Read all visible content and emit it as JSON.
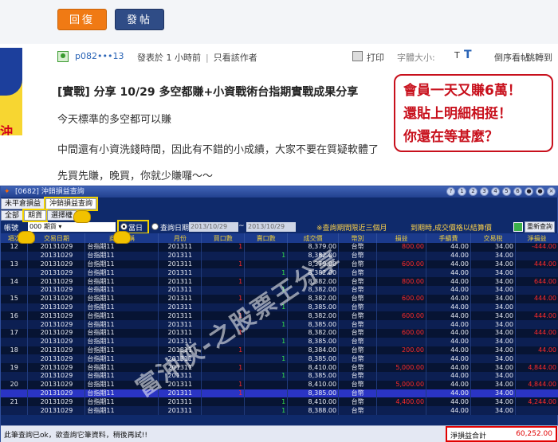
{
  "forum": {
    "reply_label": "回復",
    "post_label": "發帖",
    "user": "p082•••13",
    "meta_prefix": "發表於",
    "meta_time_num": "1",
    "meta_time_unit": "小時前",
    "only_author": "只看該作者",
    "print": "打印",
    "font_size": "字體大小:",
    "font_t_small": "T",
    "font_t_big": "T",
    "order_view": "倒序看帖",
    "jump": "跳轉到",
    "avatar_text": "沖俠"
  },
  "post": {
    "title": "[實戰] 分享 10/29 多空都賺+小資戰術台指期實戰成果分享",
    "line1": "今天標準的多空都可以賺",
    "line2": "中間還有小資洗錢時間，因此有不錯的小成績，大家不要在質疑軟體了",
    "line3": "先買先賺，晚買，你就少賺囉～～",
    "promo": [
      "會員一天又賺6萬！",
      "還貼上明細相挺！",
      "你還在等甚麼？"
    ]
  },
  "window": {
    "title": "[0682] 沖銷損益查詢",
    "controls": [
      "?",
      "1",
      "2",
      "3",
      "4",
      "5",
      "6",
      "●",
      "●",
      "×"
    ],
    "tabs": [
      "未平倉損益",
      "沖銷損益查詢"
    ],
    "subtabs": [
      "全部",
      "期貨",
      "選擇權"
    ],
    "filter": {
      "account_label": "帳號",
      "account_value": "000",
      "acct_suffix": "期貨",
      "today": "當日",
      "range": "查詢日期",
      "date_from": "2013/10/29",
      "tilde": "~",
      "date_to": "2013/10/29",
      "note1": "※查詢期間限近三個月",
      "note2": "到期時,成交價格以結算價",
      "requery": "重新查詢"
    },
    "columns": [
      "項次",
      "交易日期",
      "商品名稱",
      "月份",
      "買口數",
      "賣口數",
      "成交價",
      "幣別",
      "損益",
      "手續費",
      "交易稅",
      "淨損益"
    ],
    "rows": [
      {
        "no": "12",
        "date": "20131029",
        "prod": "台指期11",
        "month": "201311",
        "buy": "1",
        "sell": "",
        "price": "8,379.00",
        "cur": "台幣",
        "pl": "800.00",
        "fee": "44.00",
        "tax": "34.00",
        "net": "-444.00",
        "plneg": false,
        "netneg": true,
        "hl": false
      },
      {
        "no": "",
        "date": "20131029",
        "prod": "台指期11",
        "month": "201311",
        "buy": "",
        "sell": "1",
        "price": "8,382.00",
        "cur": "台幣",
        "pl": "",
        "fee": "44.00",
        "tax": "34.00",
        "net": "",
        "plneg": false,
        "netneg": false,
        "hl": false
      },
      {
        "no": "13",
        "date": "20131029",
        "prod": "台指期11",
        "month": "201311",
        "buy": "1",
        "sell": "",
        "price": "8,379.00",
        "cur": "台幣",
        "pl": "600.00",
        "fee": "44.00",
        "tax": "34.00",
        "net": "444.00",
        "plneg": false,
        "netneg": true,
        "hl": false
      },
      {
        "no": "",
        "date": "20131029",
        "prod": "台指期11",
        "month": "201311",
        "buy": "",
        "sell": "1",
        "price": "8,382.00",
        "cur": "台幣",
        "pl": "",
        "fee": "44.00",
        "tax": "34.00",
        "net": "",
        "plneg": false,
        "netneg": false,
        "hl": false
      },
      {
        "no": "14",
        "date": "20131029",
        "prod": "台指期11",
        "month": "201311",
        "buy": "1",
        "sell": "",
        "price": "8,382.00",
        "cur": "台幣",
        "pl": "800.00",
        "fee": "44.00",
        "tax": "34.00",
        "net": "644.00",
        "plneg": false,
        "netneg": true,
        "hl": false
      },
      {
        "no": "",
        "date": "20131029",
        "prod": "台指期11",
        "month": "201311",
        "buy": "",
        "sell": "1",
        "price": "8,382.00",
        "cur": "台幣",
        "pl": "",
        "fee": "44.00",
        "tax": "34.00",
        "net": "",
        "plneg": false,
        "netneg": false,
        "hl": false
      },
      {
        "no": "15",
        "date": "20131029",
        "prod": "台指期11",
        "month": "201311",
        "buy": "1",
        "sell": "",
        "price": "8,382.00",
        "cur": "台幣",
        "pl": "600.00",
        "fee": "44.00",
        "tax": "34.00",
        "net": "444.00",
        "plneg": false,
        "netneg": true,
        "hl": false
      },
      {
        "no": "",
        "date": "20131029",
        "prod": "台指期11",
        "month": "201311",
        "buy": "",
        "sell": "1",
        "price": "8,385.00",
        "cur": "台幣",
        "pl": "",
        "fee": "44.00",
        "tax": "34.00",
        "net": "",
        "plneg": false,
        "netneg": false,
        "hl": false
      },
      {
        "no": "16",
        "date": "20131029",
        "prod": "台指期11",
        "month": "201311",
        "buy": "1",
        "sell": "",
        "price": "8,382.00",
        "cur": "台幣",
        "pl": "600.00",
        "fee": "44.00",
        "tax": "34.00",
        "net": "444.00",
        "plneg": false,
        "netneg": true,
        "hl": false
      },
      {
        "no": "",
        "date": "20131029",
        "prod": "台指期11",
        "month": "201311",
        "buy": "",
        "sell": "1",
        "price": "8,385.00",
        "cur": "台幣",
        "pl": "",
        "fee": "44.00",
        "tax": "34.00",
        "net": "",
        "plneg": false,
        "netneg": false,
        "hl": false
      },
      {
        "no": "17",
        "date": "20131029",
        "prod": "台指期11",
        "month": "201311",
        "buy": "1",
        "sell": "",
        "price": "8,382.00",
        "cur": "台幣",
        "pl": "600.00",
        "fee": "44.00",
        "tax": "34.00",
        "net": "444.00",
        "plneg": false,
        "netneg": true,
        "hl": false
      },
      {
        "no": "",
        "date": "20131029",
        "prod": "台指期11",
        "month": "201311",
        "buy": "",
        "sell": "1",
        "price": "8,385.00",
        "cur": "台幣",
        "pl": "",
        "fee": "44.00",
        "tax": "34.00",
        "net": "",
        "plneg": false,
        "netneg": false,
        "hl": false
      },
      {
        "no": "18",
        "date": "20131029",
        "prod": "台指期11",
        "month": "201311",
        "buy": "1",
        "sell": "",
        "price": "8,384.00",
        "cur": "台幣",
        "pl": "200.00",
        "fee": "44.00",
        "tax": "34.00",
        "net": "44.00",
        "plneg": false,
        "netneg": true,
        "hl": false
      },
      {
        "no": "",
        "date": "20131029",
        "prod": "台指期11",
        "month": "201311",
        "buy": "",
        "sell": "1",
        "price": "8,385.00",
        "cur": "台幣",
        "pl": "",
        "fee": "44.00",
        "tax": "34.00",
        "net": "",
        "plneg": false,
        "netneg": false,
        "hl": false
      },
      {
        "no": "19",
        "date": "20131029",
        "prod": "台指期11",
        "month": "201311",
        "buy": "1",
        "sell": "",
        "price": "8,410.00",
        "cur": "台幣",
        "pl": "5,000.00",
        "fee": "44.00",
        "tax": "34.00",
        "net": "4,844.00",
        "plneg": false,
        "netneg": true,
        "hl": false
      },
      {
        "no": "",
        "date": "20131029",
        "prod": "台指期11",
        "month": "201311",
        "buy": "",
        "sell": "1",
        "price": "8,385.00",
        "cur": "台幣",
        "pl": "",
        "fee": "44.00",
        "tax": "34.00",
        "net": "",
        "plneg": false,
        "netneg": false,
        "hl": false
      },
      {
        "no": "20",
        "date": "20131029",
        "prod": "台指期11",
        "month": "201311",
        "buy": "1",
        "sell": "",
        "price": "8,410.00",
        "cur": "台幣",
        "pl": "5,000.00",
        "fee": "44.00",
        "tax": "34.00",
        "net": "4,844.00",
        "plneg": false,
        "netneg": true,
        "hl": false
      },
      {
        "no": "",
        "date": "20131029",
        "prod": "台指期11",
        "month": "201311",
        "buy": "1",
        "sell": "",
        "price": "8,385.00",
        "cur": "台幣",
        "pl": "",
        "fee": "44.00",
        "tax": "34.00",
        "net": "",
        "plneg": false,
        "netneg": false,
        "hl": true
      },
      {
        "no": "21",
        "date": "20131029",
        "prod": "台指期11",
        "month": "201311",
        "buy": "",
        "sell": "1",
        "price": "8,410.00",
        "cur": "台幣",
        "pl": "4,400.00",
        "fee": "44.00",
        "tax": "34.00",
        "net": "4,244.00",
        "plneg": false,
        "netneg": true,
        "hl": false
      },
      {
        "no": "",
        "date": "20131029",
        "prod": "台指期11",
        "month": "201311",
        "buy": "",
        "sell": "1",
        "price": "8,388.00",
        "cur": "台幣",
        "pl": "",
        "fee": "44.00",
        "tax": "34.00",
        "net": "",
        "plneg": false,
        "netneg": false,
        "hl": false
      }
    ],
    "status_msg": "此筆查詢已ok，欲查詢它筆資料，稍後再試!!",
    "total_label": "淨損益合計",
    "total_value": "60,252.00",
    "watermark": "富沖俠-之股票王分享"
  }
}
